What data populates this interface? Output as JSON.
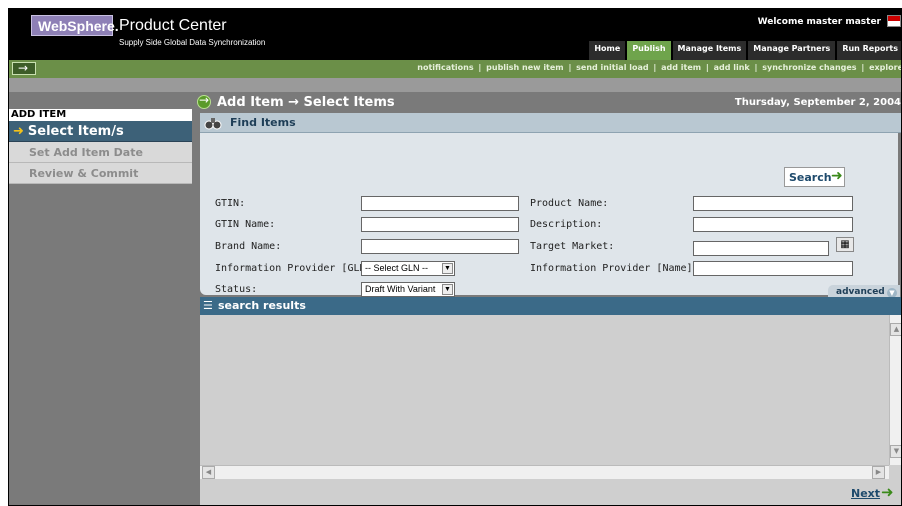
{
  "header": {
    "logo_text": "WebSphere.",
    "product_title": "Product Center",
    "product_subtitle": "Supply Side Global Data Synchronization",
    "welcome_text": "Welcome  master master",
    "tabs": [
      {
        "label": "Home",
        "active": false
      },
      {
        "label": "Publish",
        "active": true
      },
      {
        "label": "Manage Items",
        "active": false
      },
      {
        "label": "Manage Partners",
        "active": false
      },
      {
        "label": "Run Reports",
        "active": false
      }
    ]
  },
  "nav": {
    "links": [
      "notifications",
      "publish new item",
      "send initial load",
      "add item",
      "add link",
      "synchronize changes",
      "explore"
    ]
  },
  "sidebar": {
    "title": "ADD ITEM",
    "active_item": "Select Item/s",
    "items": [
      "Set Add Item Date",
      "Review & Commit"
    ]
  },
  "main": {
    "title": "Add Item → Select Items",
    "date": "Thursday, September 2, 2004"
  },
  "find": {
    "title": "Find Items",
    "search_label": "Search",
    "fields": {
      "gtin": {
        "label": "GTIN:",
        "value": ""
      },
      "gtin_name": {
        "label": "GTIN Name:",
        "value": ""
      },
      "brand_name": {
        "label": "Brand Name:",
        "value": ""
      },
      "info_provider_gln": {
        "label": "Information Provider [GLN]:",
        "selected": "-- Select GLN --"
      },
      "status": {
        "label": "Status:",
        "selected": "Draft With Variant"
      },
      "product_name": {
        "label": "Product Name:",
        "value": ""
      },
      "description": {
        "label": "Description:",
        "value": ""
      },
      "target_market": {
        "label": "Target Market:",
        "value": ""
      },
      "info_provider_name": {
        "label": "Information Provider [Name]:",
        "value": ""
      }
    },
    "advanced_label": "advanced"
  },
  "results": {
    "title": "search results",
    "next_label": "Next"
  },
  "colors": {
    "active_tab": "#6fa44c",
    "nav_bar": "#6b8f48",
    "sidebar_active": "#3d6178",
    "results_bar": "#3b6a88"
  }
}
